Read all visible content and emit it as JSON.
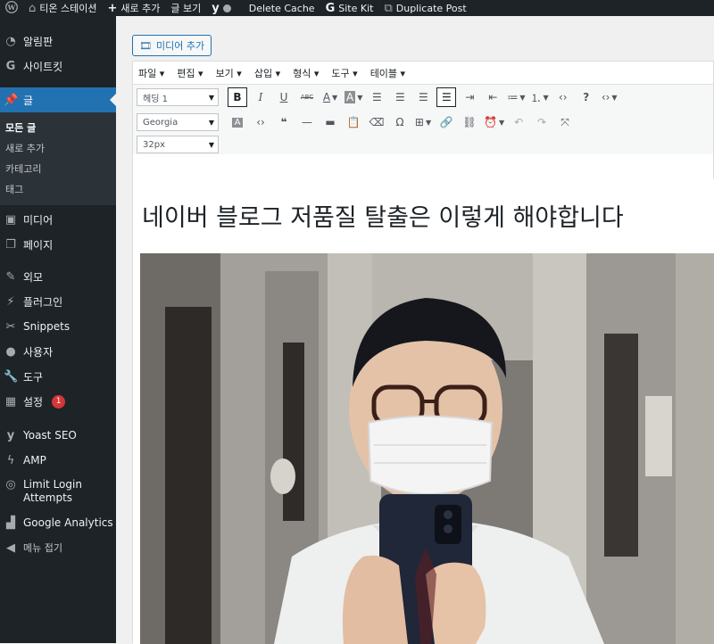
{
  "adminbar": {
    "site_name": "티온 스테이션",
    "new_label": "새로 추가",
    "view_post": "글 보기",
    "delete_cache": "Delete Cache",
    "site_kit": "Site Kit",
    "duplicate_post": "Duplicate Post"
  },
  "sidebar": {
    "dashboard": "알림판",
    "sitekit": "사이트킷",
    "posts": "글",
    "posts_sub": [
      "모든 글",
      "새로 추가",
      "카테고리",
      "태그"
    ],
    "media": "미디어",
    "pages": "페이지",
    "appearance": "외모",
    "plugins": "플러그인",
    "snippets": "Snippets",
    "users": "사용자",
    "tools": "도구",
    "settings": "설정",
    "settings_badge": "1",
    "yoast": "Yoast SEO",
    "amp": "AMP",
    "limit_login_1": "Limit Login",
    "limit_login_2": "Attempts",
    "analytics": "Google Analytics",
    "collapse": "메뉴 접기"
  },
  "editor": {
    "add_media": "미디어 추가",
    "menubar": [
      "파일",
      "편집",
      "보기",
      "삽입",
      "형식",
      "도구",
      "테이블"
    ],
    "format_select": "헤딩 1",
    "font_select": "Georgia",
    "size_select": "32px",
    "post_title": "네이버 블로그 저품질 탈출은 이렇게 해야합니다"
  },
  "colors": {
    "admin_bg": "#1d2327",
    "accent": "#2271b1",
    "badge": "#d63638"
  }
}
